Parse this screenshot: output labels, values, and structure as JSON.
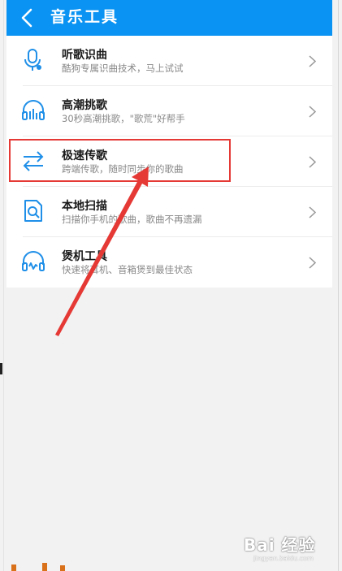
{
  "header": {
    "title": "音乐工具",
    "bg_color": "#0a93f2"
  },
  "tools": [
    {
      "name": "听歌识曲",
      "desc": "酷狗专属识曲技术，马上试试",
      "icon": "microphone-icon"
    },
    {
      "name": "高潮挑歌",
      "desc": "30秒高潮挑歌，\"歌荒\"好帮手",
      "icon": "headphones-bars-icon"
    },
    {
      "name": "极速传歌",
      "desc": "跨端传歌，随时同步你的歌曲",
      "icon": "transfer-arrows-icon"
    },
    {
      "name": "本地扫描",
      "desc": "扫描你手机的歌曲，歌曲不再遗漏",
      "icon": "scan-file-icon"
    },
    {
      "name": "煲机工具",
      "desc": "快速将耳机、音箱煲到最佳状态",
      "icon": "headphones-wave-icon"
    }
  ],
  "highlight_color": "#e53935",
  "accent_color": "#1f8fe8",
  "watermark": {
    "text": "Bai 经验",
    "sub": "jingyan.baidu.com"
  }
}
